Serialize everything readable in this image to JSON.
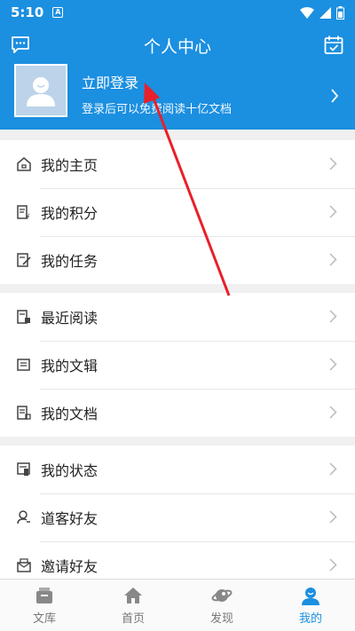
{
  "status": {
    "time": "5:10",
    "notif": "A"
  },
  "header": {
    "title": "个人中心",
    "login_label": "立即登录",
    "login_sub": "登录后可以免费阅读十亿文档"
  },
  "group1": [
    {
      "label": "我的主页",
      "icon": "home-icon"
    },
    {
      "label": "我的积分",
      "icon": "points-icon"
    },
    {
      "label": "我的任务",
      "icon": "task-icon"
    }
  ],
  "group2": [
    {
      "label": "最近阅读",
      "icon": "recent-reading-icon"
    },
    {
      "label": "我的文辑",
      "icon": "collection-icon"
    },
    {
      "label": "我的文档",
      "icon": "document-icon"
    }
  ],
  "group3": [
    {
      "label": "我的状态",
      "icon": "status-icon"
    },
    {
      "label": "道客好友",
      "icon": "friends-icon"
    },
    {
      "label": "邀请好友",
      "icon": "invite-icon"
    }
  ],
  "tabs": [
    {
      "label": "文库",
      "icon": "library-icon"
    },
    {
      "label": "首页",
      "icon": "home-icon"
    },
    {
      "label": "发现",
      "icon": "discover-icon"
    },
    {
      "label": "我的",
      "icon": "profile-icon"
    }
  ],
  "colors": {
    "primary": "#1b8fe0",
    "annotation": "#e8202a"
  }
}
